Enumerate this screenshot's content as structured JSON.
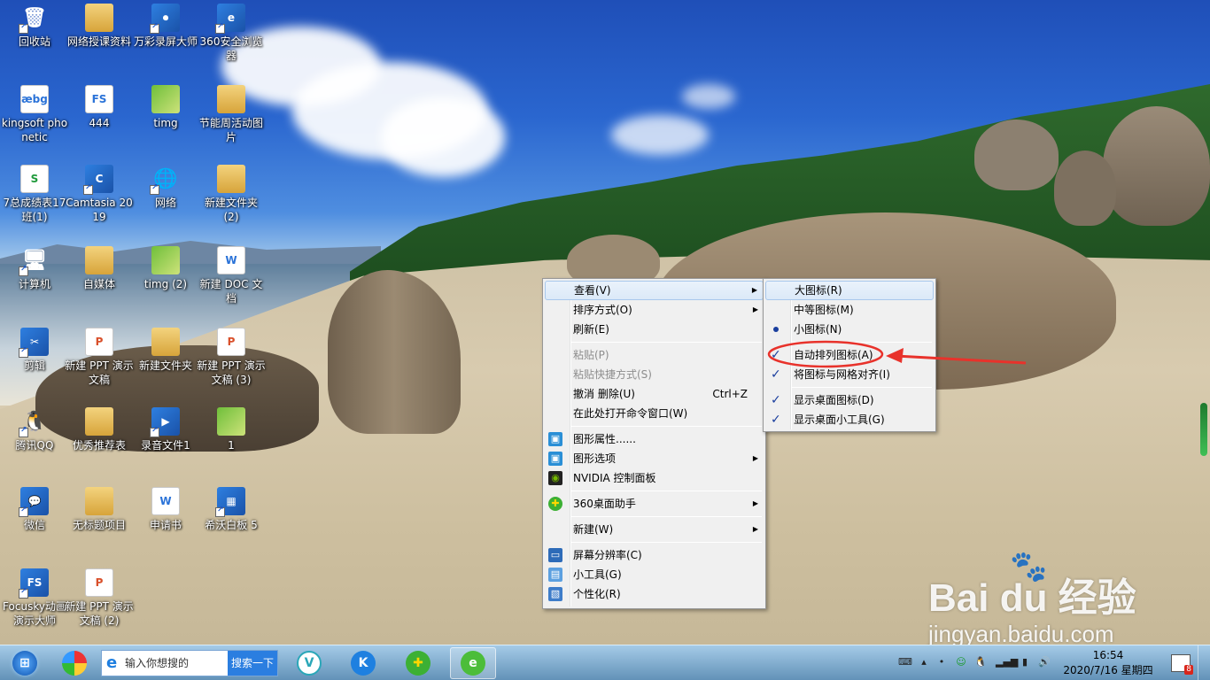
{
  "desktop_icons": [
    {
      "name": "recycle-bin-icon",
      "label": "回收站",
      "glyph": "🗑",
      "kind": "plain"
    },
    {
      "name": "folder-icon",
      "label": "网络授课资料",
      "glyph": "",
      "kind": "folder"
    },
    {
      "name": "screen-recorder-icon",
      "label": "万彩录屏大师",
      "glyph": "⏺",
      "kind": "app"
    },
    {
      "name": "browser-360-icon",
      "label": "360安全浏览器",
      "glyph": "e",
      "kind": "app"
    },
    {
      "name": "kingsoft-phonetic-icon",
      "label": "kingsoft phonetic",
      "glyph": "æbg",
      "kind": "doc"
    },
    {
      "name": "flash-file-icon",
      "label": "444",
      "glyph": "FS",
      "kind": "doc"
    },
    {
      "name": "image-file-icon",
      "label": "timg",
      "glyph": "",
      "kind": "img"
    },
    {
      "name": "folder-icon",
      "label": "节能周活动图片",
      "glyph": "",
      "kind": "folder"
    },
    {
      "name": "spreadsheet-icon",
      "label": "7总成绩表17班(1)",
      "glyph": "S",
      "kind": "xls"
    },
    {
      "name": "camtasia-icon",
      "label": "Camtasia 2019",
      "glyph": "C",
      "kind": "app"
    },
    {
      "name": "network-icon",
      "label": "网络",
      "glyph": "🌐",
      "kind": "plain"
    },
    {
      "name": "folder-icon",
      "label": "新建文件夹 (2)",
      "glyph": "",
      "kind": "folder"
    },
    {
      "name": "computer-icon",
      "label": "计算机",
      "glyph": "🖥",
      "kind": "plain"
    },
    {
      "name": "folder-icon",
      "label": "自媒体",
      "glyph": "",
      "kind": "folder"
    },
    {
      "name": "image-file-icon",
      "label": "timg (2)",
      "glyph": "",
      "kind": "img"
    },
    {
      "name": "word-doc-icon",
      "label": "新建 DOC 文档",
      "glyph": "W",
      "kind": "doc"
    },
    {
      "name": "jianying-icon",
      "label": "剪辑",
      "glyph": "✂",
      "kind": "app"
    },
    {
      "name": "ppt-doc-icon",
      "label": "新建 PPT 演示文稿",
      "glyph": "P",
      "kind": "ppt"
    },
    {
      "name": "folder-icon",
      "label": "新建文件夹",
      "glyph": "",
      "kind": "folder"
    },
    {
      "name": "ppt-doc-icon",
      "label": "新建 PPT 演示文稿 (3)",
      "glyph": "P",
      "kind": "ppt"
    },
    {
      "name": "qq-icon",
      "label": "腾讯QQ",
      "glyph": "🐧",
      "kind": "plain"
    },
    {
      "name": "folder-icon",
      "label": "优秀推荐表",
      "glyph": "",
      "kind": "folder"
    },
    {
      "name": "audio-file-icon",
      "label": "录音文件1",
      "glyph": "▶",
      "kind": "app"
    },
    {
      "name": "image-file-icon",
      "label": "1",
      "glyph": "",
      "kind": "img"
    },
    {
      "name": "wechat-icon",
      "label": "微信",
      "glyph": "💬",
      "kind": "app"
    },
    {
      "name": "folder-icon",
      "label": "无标题项目",
      "glyph": "",
      "kind": "folder"
    },
    {
      "name": "word-doc-icon",
      "label": "申请书",
      "glyph": "W",
      "kind": "doc"
    },
    {
      "name": "whiteboard-icon",
      "label": "希沃白板 5",
      "glyph": "▦",
      "kind": "app"
    },
    {
      "name": "focusky-icon",
      "label": "Focusky动画演示大师",
      "glyph": "FS",
      "kind": "app"
    },
    {
      "name": "ppt-doc-icon",
      "label": "新建 PPT 演示文稿 (2)",
      "glyph": "P",
      "kind": "ppt"
    }
  ],
  "context_menu": {
    "view": "查看(V)",
    "sort": "排序方式(O)",
    "refresh": "刷新(E)",
    "paste": "粘贴(P)",
    "paste_shortcut": "粘贴快捷方式(S)",
    "undo_delete": "撤消 删除(U)",
    "undo_shortcut": "Ctrl+Z",
    "open_cmd": "在此处打开命令窗口(W)",
    "graphics_props": "图形属性......",
    "graphics_options": "图形选项",
    "nvidia": "NVIDIA 控制面板",
    "desk_helper": "360桌面助手",
    "new": "新建(W)",
    "resolution": "屏幕分辨率(C)",
    "gadgets": "小工具(G)",
    "personalize": "个性化(R)"
  },
  "view_submenu": {
    "large_icons": "大图标(R)",
    "medium_icons": "中等图标(M)",
    "small_icons": "小图标(N)",
    "auto_arrange": "自动排列图标(A)",
    "align_grid": "将图标与网格对齐(I)",
    "show_desktop_icons": "显示桌面图标(D)",
    "show_gadgets": "显示桌面小工具(G)"
  },
  "taskbar": {
    "search_placeholder": "输入你想搜的",
    "search_button": "搜索一下",
    "time": "16:54",
    "date": "2020/7/16 星期四",
    "notification_count": "8"
  },
  "watermark": {
    "brand": "Bai du 经验",
    "url": "jingyan.baidu.com"
  },
  "colors": {
    "annotation_red": "#e8322b",
    "menu_bg": "#f0f0f0",
    "menu_highlight": "#dbe9f8"
  }
}
